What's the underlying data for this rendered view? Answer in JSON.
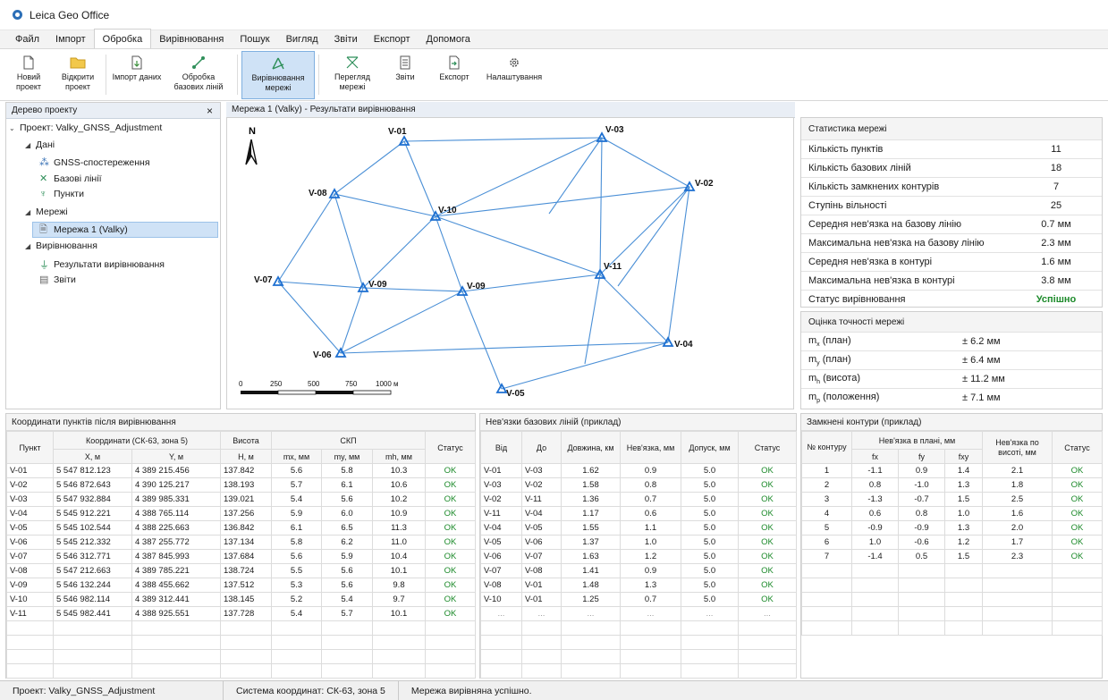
{
  "window": {
    "title": "Leica Geo Office"
  },
  "menu": [
    "Файл",
    "Імпорт",
    "Обробка",
    "Вирівнювання",
    "Пошук",
    "Вигляд",
    "Звіти",
    "Експорт",
    "Допомога"
  ],
  "ribbon": [
    {
      "label": "Новий проект",
      "icon": "new-doc-icon"
    },
    {
      "label": "Відкрити проект",
      "icon": "open-folder-icon"
    },
    {
      "label": "Імпорт даних",
      "icon": "import-icon"
    },
    {
      "label": "Обробка базових ліній",
      "icon": "baseline-icon"
    },
    {
      "label": "Вирівнювання мережі",
      "icon": "network-adjust-icon"
    },
    {
      "label": "Перегляд мережі",
      "icon": "network-view-icon"
    },
    {
      "label": "Звіти",
      "icon": "report-icon"
    },
    {
      "label": "Експорт",
      "icon": "export-icon"
    },
    {
      "label": "Налаштування",
      "icon": "gear-icon"
    }
  ],
  "tree": {
    "title": "Дерево проекту",
    "close": "×",
    "project": "Проект: Valky_GNSS_Adjustment",
    "data": "Дані",
    "gnss": "GNSS-спостереження",
    "baselines": "Базові лінії",
    "points": "Пункти",
    "networks": "Мережі",
    "network1": "Мережа 1 (Valky)",
    "adjustment": "Вирівнювання",
    "results": "Результати вирівнювання",
    "reports": "Звіти"
  },
  "map": {
    "title": "Мережа 1 (Valky) - Результати вирівнювання",
    "north": "N",
    "scale_labels": [
      "0",
      "250",
      "500",
      "750",
      "1000 м"
    ],
    "points": [
      {
        "name": "V-01"
      },
      {
        "name": "V-03"
      },
      {
        "name": "V-02"
      },
      {
        "name": "V-08"
      },
      {
        "name": "V-10"
      },
      {
        "name": "V-07"
      },
      {
        "name": "V-09"
      },
      {
        "name": "V-09"
      },
      {
        "name": "V-11"
      },
      {
        "name": "V-06"
      },
      {
        "name": "V-04"
      },
      {
        "name": "V-05"
      }
    ]
  },
  "stats": {
    "title": "Статистика мережі",
    "rows": [
      {
        "k": "Кількість пунктів",
        "v": "11"
      },
      {
        "k": "Кількість базових ліній",
        "v": "18"
      },
      {
        "k": "Кількість замкнених контурів",
        "v": "7"
      },
      {
        "k": "Ступінь вільності",
        "v": "25"
      },
      {
        "k": "Середня нев'язка на базову лінію",
        "v": "0.7 мм"
      },
      {
        "k": "Максимальна нев'язка на базову лінію",
        "v": "2.3 мм"
      },
      {
        "k": "Середня нев'язка в контурі",
        "v": "1.6 мм"
      },
      {
        "k": "Максимальна нев'язка в контурі",
        "v": "3.8 мм"
      },
      {
        "k": "Статус вирівнювання",
        "v": "Успішно"
      }
    ],
    "status_color": "#1c8a2a"
  },
  "accuracy": {
    "title": "Оцінка точності мережі",
    "rows": [
      {
        "sym": "m",
        "sub": "x",
        "k": " (план)",
        "v": "± 6.2 мм"
      },
      {
        "sym": "m",
        "sub": "y",
        "k": " (план)",
        "v": "± 6.4 мм"
      },
      {
        "sym": "m",
        "sub": "h",
        "k": " (висота)",
        "v": "± 11.2 мм"
      },
      {
        "sym": "m",
        "sub": "p",
        "k": " (положення)",
        "v": "± 7.1 мм"
      }
    ]
  },
  "coords": {
    "title": "Координати пунктів після вирівнювання",
    "h_point": "Пункт",
    "h_coords": "Координати (СК-63, зона 5)",
    "h_height": "Висота",
    "h_skp": "СКП",
    "h_status": "Статус",
    "h_x": "X, м",
    "h_y": "Y, м",
    "h_h": "H, м",
    "h_mx": "mx, мм",
    "h_my": "my, мм",
    "h_mh": "mh, мм",
    "rows": [
      [
        "V-01",
        "5 547 812.123",
        "4 389 215.456",
        "137.842",
        "5.6",
        "5.8",
        "10.3",
        "OK"
      ],
      [
        "V-02",
        "5 546 872.643",
        "4 390 125.217",
        "138.193",
        "5.7",
        "6.1",
        "10.6",
        "OK"
      ],
      [
        "V-03",
        "5 547 932.884",
        "4 389 985.331",
        "139.021",
        "5.4",
        "5.6",
        "10.2",
        "OK"
      ],
      [
        "V-04",
        "5 545 912.221",
        "4 388 765.114",
        "137.256",
        "5.9",
        "6.0",
        "10.9",
        "OK"
      ],
      [
        "V-05",
        "5 545 102.544",
        "4 388 225.663",
        "136.842",
        "6.1",
        "6.5",
        "11.3",
        "OK"
      ],
      [
        "V-06",
        "5 545 212.332",
        "4 387 255.772",
        "137.134",
        "5.8",
        "6.2",
        "11.0",
        "OK"
      ],
      [
        "V-07",
        "5 546 312.771",
        "4 387 845.993",
        "137.684",
        "5.6",
        "5.9",
        "10.4",
        "OK"
      ],
      [
        "V-08",
        "5 547 212.663",
        "4 389 785.221",
        "138.724",
        "5.5",
        "5.6",
        "10.1",
        "OK"
      ],
      [
        "V-09",
        "5 546 132.244",
        "4 388 455.662",
        "137.512",
        "5.3",
        "5.6",
        "9.8",
        "OK"
      ],
      [
        "V-10",
        "5 546 982.114",
        "4 389 312.441",
        "138.145",
        "5.2",
        "5.4",
        "9.7",
        "OK"
      ],
      [
        "V-11",
        "5 545 982.441",
        "4 388 925.551",
        "137.728",
        "5.4",
        "5.7",
        "10.1",
        "OK"
      ]
    ]
  },
  "baselines": {
    "title": "Нев'язки базових ліній (приклад)",
    "headers": [
      "Від",
      "До",
      "Довжина, км",
      "Нев'язка, мм",
      "Допуск, мм",
      "Статус"
    ],
    "rows": [
      [
        "V-01",
        "V-03",
        "1.62",
        "0.9",
        "5.0",
        "OK"
      ],
      [
        "V-03",
        "V-02",
        "1.58",
        "0.8",
        "5.0",
        "OK"
      ],
      [
        "V-02",
        "V-11",
        "1.36",
        "0.7",
        "5.0",
        "OK"
      ],
      [
        "V-11",
        "V-04",
        "1.17",
        "0.6",
        "5.0",
        "OK"
      ],
      [
        "V-04",
        "V-05",
        "1.55",
        "1.1",
        "5.0",
        "OK"
      ],
      [
        "V-05",
        "V-06",
        "1.37",
        "1.0",
        "5.0",
        "OK"
      ],
      [
        "V-06",
        "V-07",
        "1.63",
        "1.2",
        "5.0",
        "OK"
      ],
      [
        "V-07",
        "V-08",
        "1.41",
        "0.9",
        "5.0",
        "OK"
      ],
      [
        "V-08",
        "V-01",
        "1.48",
        "1.3",
        "5.0",
        "OK"
      ],
      [
        "V-10",
        "V-01",
        "1.25",
        "0.7",
        "5.0",
        "OK"
      ],
      [
        "...",
        "...",
        "...",
        "...",
        "...",
        "..."
      ]
    ]
  },
  "loops": {
    "title": "Замкнені контури (приклад)",
    "h_no": "№ контуру",
    "h_plan": "Нев'язка в плані, мм",
    "h_height": "Нев'язка по висоті, мм",
    "h_status": "Статус",
    "h_fx": "fx",
    "h_fy": "fy",
    "h_fxy": "fxy",
    "rows": [
      [
        "1",
        "-1.1",
        "0.9",
        "1.4",
        "2.1",
        "OK"
      ],
      [
        "2",
        "0.8",
        "-1.0",
        "1.3",
        "1.8",
        "OK"
      ],
      [
        "3",
        "-1.3",
        "-0.7",
        "1.5",
        "2.5",
        "OK"
      ],
      [
        "4",
        "0.6",
        "0.8",
        "1.0",
        "1.6",
        "OK"
      ],
      [
        "5",
        "-0.9",
        "-0.9",
        "1.3",
        "2.0",
        "OK"
      ],
      [
        "6",
        "1.0",
        "-0.6",
        "1.2",
        "1.7",
        "OK"
      ],
      [
        "7",
        "-1.4",
        "0.5",
        "1.5",
        "2.3",
        "OK"
      ]
    ]
  },
  "statusbar": {
    "project": "Проект: Valky_GNSS_Adjustment",
    "crs": "Система координат: СК-63, зона 5",
    "message": "Мережа вирівняна успішно."
  },
  "colors": {
    "accent": "#2c6fb7",
    "line": "#4a8fd6",
    "ok": "#1c8a2a"
  }
}
